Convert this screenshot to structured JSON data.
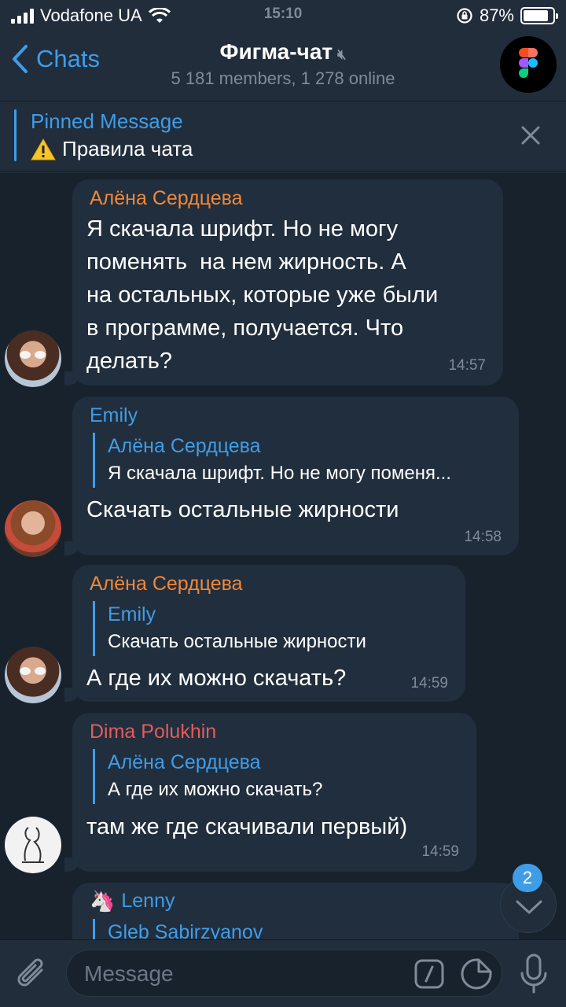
{
  "status_bar": {
    "carrier": "Vodafone UA",
    "time": "15:10",
    "battery": "87%",
    "battery_level": 0.87
  },
  "nav": {
    "back_label": "Chats",
    "title": "Фигма-чат",
    "subtitle": "5 181 members, 1 278 online"
  },
  "pinned": {
    "label": "Pinned Message",
    "text": "Правила чата"
  },
  "messages": [
    {
      "sender": "Алёна Сердцева",
      "lines": [
        "Я скачала шрифт. Но не могу",
        "поменять  на нем жирность. А",
        "на остальных, которые уже были",
        "в программе, получается. Что",
        "делать?"
      ],
      "time": "14:57"
    },
    {
      "sender": "Emily",
      "reply_name": "Алёна Сердцева",
      "reply_text": "Я скачала шрифт. Но не могу поменя...",
      "text": "Скачать остальные жирности",
      "time": "14:58"
    },
    {
      "sender": "Алёна Сердцева",
      "reply_name": "Emily",
      "reply_text": "Скачать остальные жирности",
      "text": "А где их можно скачать?",
      "time": "14:59"
    },
    {
      "sender": "Dima Polukhin",
      "reply_name": "Алёна Сердцева",
      "reply_text": "А где их можно скачать?",
      "text": "там же где скачивали первый)",
      "time": "14:59"
    },
    {
      "sender": "Lenny",
      "reply_name": "Gleb Sabirzyanov"
    }
  ],
  "scroll_badge": "2",
  "composer": {
    "placeholder": "Message"
  },
  "colors": {
    "accent": "#3f9de8",
    "sender_orange": "#f0883a",
    "sender_red": "#e35c5c",
    "background": "#18222d",
    "bubble": "#212e3d"
  }
}
